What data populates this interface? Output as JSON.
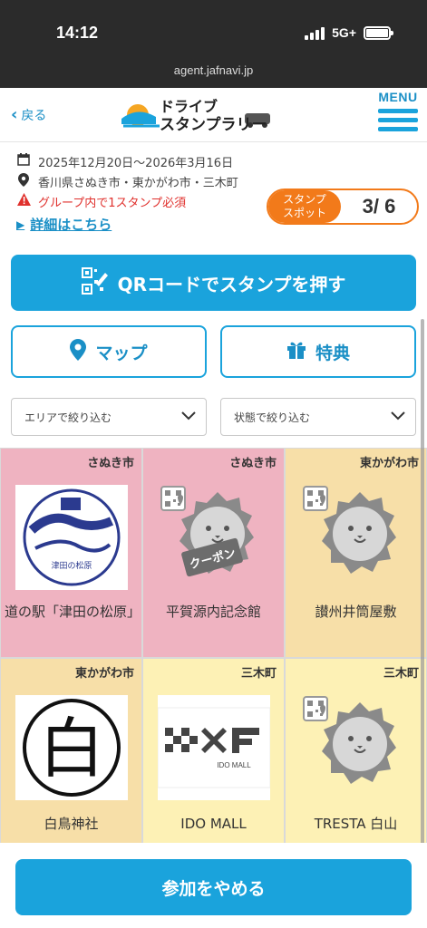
{
  "status_bar": {
    "time": "14:12",
    "network": "5G+",
    "url": "agent.jafnavi.jp"
  },
  "header": {
    "back_label": "戻る",
    "logo_line1": "ドライブ",
    "logo_line2": "スタンプラリー",
    "menu_label": "MENU"
  },
  "event": {
    "dates": "2025年12月20日〜2026年3月16日",
    "location": "香川県さぬき市・東かがわ市・三木町",
    "warning": "グループ内で1スタンプ必須",
    "detail_link": "詳細はこちら"
  },
  "stamp_spot": {
    "label": "スタンプ\nスポット",
    "count_text": "3/ 6"
  },
  "actions": {
    "qr_button": "QRコードでスタンプを押す",
    "map_button": "マップ",
    "benefit_button": "特典",
    "area_filter": "エリアで絞り込む",
    "status_filter": "状態で絞り込む",
    "quit_button": "参加をやめる"
  },
  "spots": [
    {
      "area": "さぬき市",
      "name": "道の駅「津田の松原」",
      "stamped": true,
      "bg": "#efb3c1",
      "icon": "tsuda-stamp-icon"
    },
    {
      "area": "さぬき市",
      "name": "平賀源内記念館",
      "stamped": false,
      "coupon": "クーポン",
      "bg": "#efb3c1",
      "icon": "lion-coupon-icon"
    },
    {
      "area": "東かがわ市",
      "name": "讃州井筒屋敷",
      "stamped": false,
      "bg": "#f7dfa8",
      "icon": "lion-icon"
    },
    {
      "area": "東かがわ市",
      "name": "白鳥神社",
      "stamped": true,
      "glyph": "白",
      "bg": "#f7dfa8",
      "icon": "shiratori-stamp-icon"
    },
    {
      "area": "三木町",
      "name": "IDO MALL",
      "stamped": true,
      "mall_text": "IDO MALL",
      "bg": "#fdf1b5",
      "icon": "ido-mall-logo-icon"
    },
    {
      "area": "三木町",
      "name": "TRESTA 白山",
      "stamped": false,
      "bg": "#fdf1b5",
      "icon": "lion-icon"
    }
  ],
  "colors": {
    "accent": "#1aa3dc",
    "orange": "#f27a1a",
    "warning": "#e0312d"
  }
}
